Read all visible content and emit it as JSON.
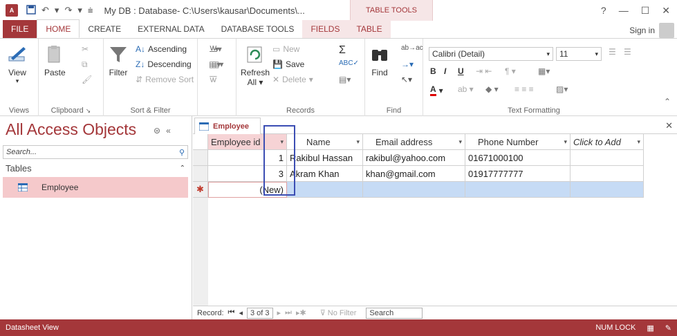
{
  "window": {
    "app_icon": "A",
    "title": "My DB : Database- C:\\Users\\kausar\\Documents\\...",
    "context_group": "TABLE TOOLS",
    "help": "?",
    "minimize": "—",
    "restore": "☐",
    "close": "✕"
  },
  "ribbon_tabs": {
    "file": "FILE",
    "home": "HOME",
    "create": "CREATE",
    "external": "EXTERNAL DATA",
    "dbtools": "DATABASE TOOLS",
    "fields": "FIELDS",
    "table": "TABLE",
    "signin": "Sign in"
  },
  "ribbon": {
    "views": {
      "view": "View",
      "label": "Views"
    },
    "clipboard": {
      "paste": "Paste",
      "label": "Clipboard"
    },
    "sort_filter": {
      "filter": "Filter",
      "ascending": "Ascending",
      "descending": "Descending",
      "remove_sort": "Remove Sort",
      "label": "Sort & Filter"
    },
    "records": {
      "new": "New",
      "save": "Save",
      "delete": "Delete",
      "refresh": "Refresh",
      "refresh_all": "All",
      "label": "Records"
    },
    "find": {
      "find": "Find",
      "label": "Find"
    },
    "text_formatting": {
      "font": "Calibri (Detail)",
      "size": "11",
      "label": "Text Formatting"
    }
  },
  "nav_pane": {
    "title": "All Access Objects",
    "search_placeholder": "Search...",
    "section": "Tables",
    "items": [
      {
        "label": "Employee"
      }
    ]
  },
  "document": {
    "tab_label": "Employee",
    "columns": [
      "Employee id",
      "Name",
      "Email address",
      "Phone Number",
      "Click to Add"
    ],
    "rows": [
      {
        "id": "1",
        "name": "Rakibul Hassan",
        "email": "rakibul@yahoo.com",
        "phone": "01671000100"
      },
      {
        "id": "3",
        "name": "Akram Khan",
        "email": "khan@gmail.com",
        "phone": "01917777777"
      }
    ],
    "new_row_marker": "✱",
    "new_row_text": "(New)"
  },
  "record_nav": {
    "record_label": "Record:",
    "position": "3 of 3",
    "no_filter": "No Filter",
    "search": "Search"
  },
  "status_bar": {
    "view": "Datasheet View",
    "num_lock": "NUM LOCK"
  },
  "colors": {
    "accent": "#a4373a",
    "new_row": "#c6dbf5",
    "nav_selected": "#f5c9cb"
  }
}
